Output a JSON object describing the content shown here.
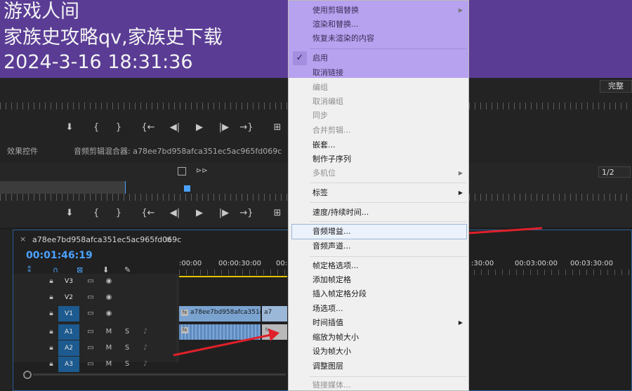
{
  "watermark": {
    "line1": "游戏人间",
    "line2": "家族史攻略qv,家族史下载",
    "line3": "2024-3-16 18:31:36"
  },
  "program_monitor": {
    "quality": "完整",
    "controls": [
      "⬇",
      "{",
      "}",
      "{←",
      "◀|",
      "▶",
      "|▶",
      "→}",
      "⊞"
    ]
  },
  "panels": {
    "tab_effects": "效果控件",
    "tab_mixer": "音频剪辑混合器: a78ee7bd958afca351ec5ac965fd069c",
    "source_ratio": "1/2"
  },
  "timeline": {
    "close_label": "×",
    "sequence_name": "a78ee7bd958afca351ec5ac965fd069c",
    "menu_label": "≡",
    "timecode": "00:01:46:19",
    "ruler": [
      ":00:00",
      "00:00:30:00",
      "00:",
      ":30:00",
      "00:03:00:00",
      "00:03:30:00"
    ],
    "tracks": [
      {
        "label": "V3",
        "active": false,
        "kind": "video"
      },
      {
        "label": "V2",
        "active": false,
        "kind": "video"
      },
      {
        "label": "V1",
        "active": true,
        "kind": "video"
      },
      {
        "label": "A1",
        "active": true,
        "kind": "audio"
      },
      {
        "label": "A2",
        "active": true,
        "kind": "audio"
      },
      {
        "label": "A3",
        "active": true,
        "kind": "audio"
      }
    ],
    "clip_v1": "a78ee7bd958afca351e",
    "clip_v1b": "a7",
    "fx_badge": "fx",
    "mute": "M",
    "solo": "S"
  },
  "context_menu": {
    "items_top": [
      {
        "label": "使用剪辑替换",
        "disabled": true,
        "submenu": true
      },
      {
        "label": "渲染和替换...",
        "disabled": false,
        "submenu": false
      },
      {
        "label": "恢复未渲染的内容",
        "disabled": true,
        "submenu": false
      }
    ],
    "enabled_check": "✓",
    "items_link": [
      {
        "label": "启用",
        "disabled": false
      },
      {
        "label": "取消链接",
        "disabled": false
      }
    ],
    "items_group": [
      {
        "label": "编组",
        "disabled": true
      },
      {
        "label": "取消编组",
        "disabled": true
      },
      {
        "label": "同步",
        "disabled": true
      },
      {
        "label": "合并剪辑...",
        "disabled": true
      },
      {
        "label": "嵌套...",
        "disabled": false
      },
      {
        "label": "制作子序列",
        "disabled": false
      },
      {
        "label": "多机位",
        "disabled": true,
        "submenu": true
      }
    ],
    "label_item": "标签",
    "speed_item": "速度/持续时间...",
    "audio_gain": "音频增益...",
    "audio_channels": "音频声道...",
    "items_frame": [
      {
        "label": "帧定格选项..."
      },
      {
        "label": "添加帧定格"
      },
      {
        "label": "插入帧定格分段"
      },
      {
        "label": "场选项..."
      },
      {
        "label": "时间插值",
        "submenu": true
      },
      {
        "label": "缩放为帧大小"
      },
      {
        "label": "设为帧大小"
      },
      {
        "label": "调整图层"
      }
    ],
    "link_media": "链接媒体...",
    "submenu_arrow": "▶"
  },
  "colors": {
    "banner": "#5a3c95",
    "menu_highlight": "#b6a2ee",
    "annotation": "#e0202a",
    "track_active": "#1c5a8f",
    "timecode": "#4aa3ff"
  }
}
